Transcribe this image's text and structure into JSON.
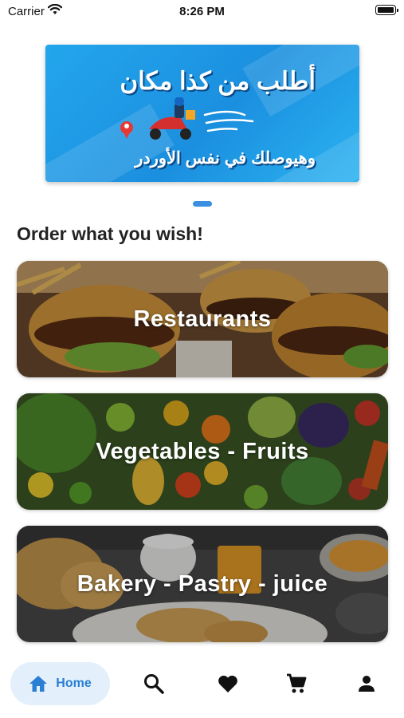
{
  "status_bar": {
    "carrier": "Carrier",
    "time": "8:26 PM"
  },
  "banner": {
    "title": "أطلب من كذا مكان",
    "subtitle": "وهيوصلك في نفس الأوردر"
  },
  "section_title": "Order what you wish!",
  "categories": [
    {
      "label": "Restaurants"
    },
    {
      "label": "Vegetables - Fruits"
    },
    {
      "label": "Bakery - Pastry - juice"
    }
  ],
  "nav": {
    "home_label": "Home",
    "icons": [
      "home-icon",
      "search-icon",
      "heart-icon",
      "cart-icon",
      "profile-icon"
    ]
  },
  "colors": {
    "accent": "#2a7fd4",
    "home_pill": "#e3f0fc",
    "banner": "#1b8fdf"
  }
}
